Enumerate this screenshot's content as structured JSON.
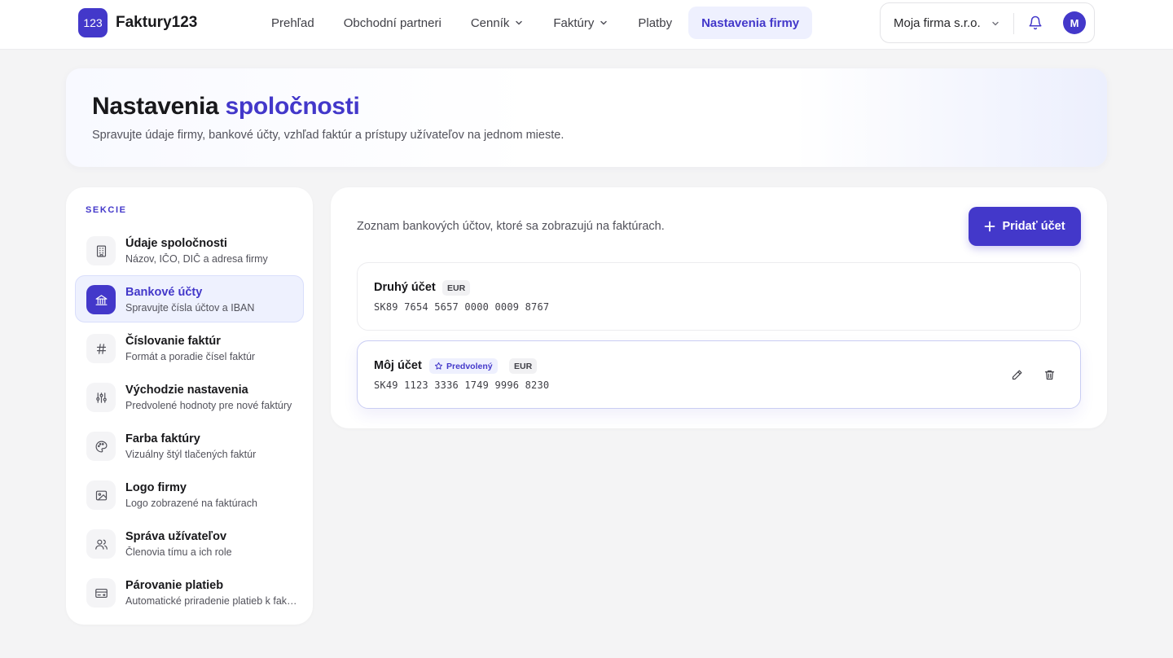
{
  "app": {
    "logo_badge": "123",
    "name": "Faktury123"
  },
  "nav": {
    "items": [
      {
        "label": "Prehľad"
      },
      {
        "label": "Obchodní partneri"
      },
      {
        "label": "Cenník"
      },
      {
        "label": "Faktúry"
      },
      {
        "label": "Platby"
      },
      {
        "label": "Nastavenia firmy"
      }
    ]
  },
  "account": {
    "company": "Moja firma s.r.o.",
    "avatar_initial": "M"
  },
  "hero": {
    "title_main": "Nastavenia",
    "title_accent": "spoločnosti",
    "subtitle": "Spravujte údaje firmy, bankové účty, vzhľad faktúr a prístupy užívateľov na jednom mieste."
  },
  "sidebar": {
    "heading": "SEKCIE",
    "items": [
      {
        "label": "Údaje spoločnosti",
        "desc": "Názov, IČO, DIČ a adresa firmy",
        "icon": "building-icon"
      },
      {
        "label": "Bankové účty",
        "desc": "Spravujte čísla účtov a IBAN",
        "icon": "bank-icon"
      },
      {
        "label": "Číslovanie faktúr",
        "desc": "Formát a poradie čísel faktúr",
        "icon": "hash-icon"
      },
      {
        "label": "Východzie nastavenia",
        "desc": "Predvolené hodnoty pre nové faktúry",
        "icon": "sliders-icon"
      },
      {
        "label": "Farba faktúry",
        "desc": "Vizuálny štýl tlačených faktúr",
        "icon": "palette-icon"
      },
      {
        "label": "Logo firmy",
        "desc": "Logo zobrazené na faktúrach",
        "icon": "image-icon"
      },
      {
        "label": "Správa užívateľov",
        "desc": "Členovia tímu a ich role",
        "icon": "users-icon"
      },
      {
        "label": "Párovanie platieb",
        "desc": "Automatické priradenie platieb k faktúram",
        "icon": "card-icon"
      }
    ]
  },
  "bank": {
    "description": "Zoznam bankových účtov, ktoré sa zobrazujú na faktúrach.",
    "add_label": "Pridať účet",
    "accounts": [
      {
        "name": "Druhý účet",
        "currency": "EUR",
        "iban": "SK89 7654 5657 0000 0009 8767"
      },
      {
        "name": "Môj účet",
        "default_label": "Predvolený",
        "currency": "EUR",
        "iban": "SK49 1123 3336 1749 9996 8230"
      }
    ]
  },
  "colors": {
    "accent": "#4338ca",
    "accent_light": "#eef0fe"
  }
}
